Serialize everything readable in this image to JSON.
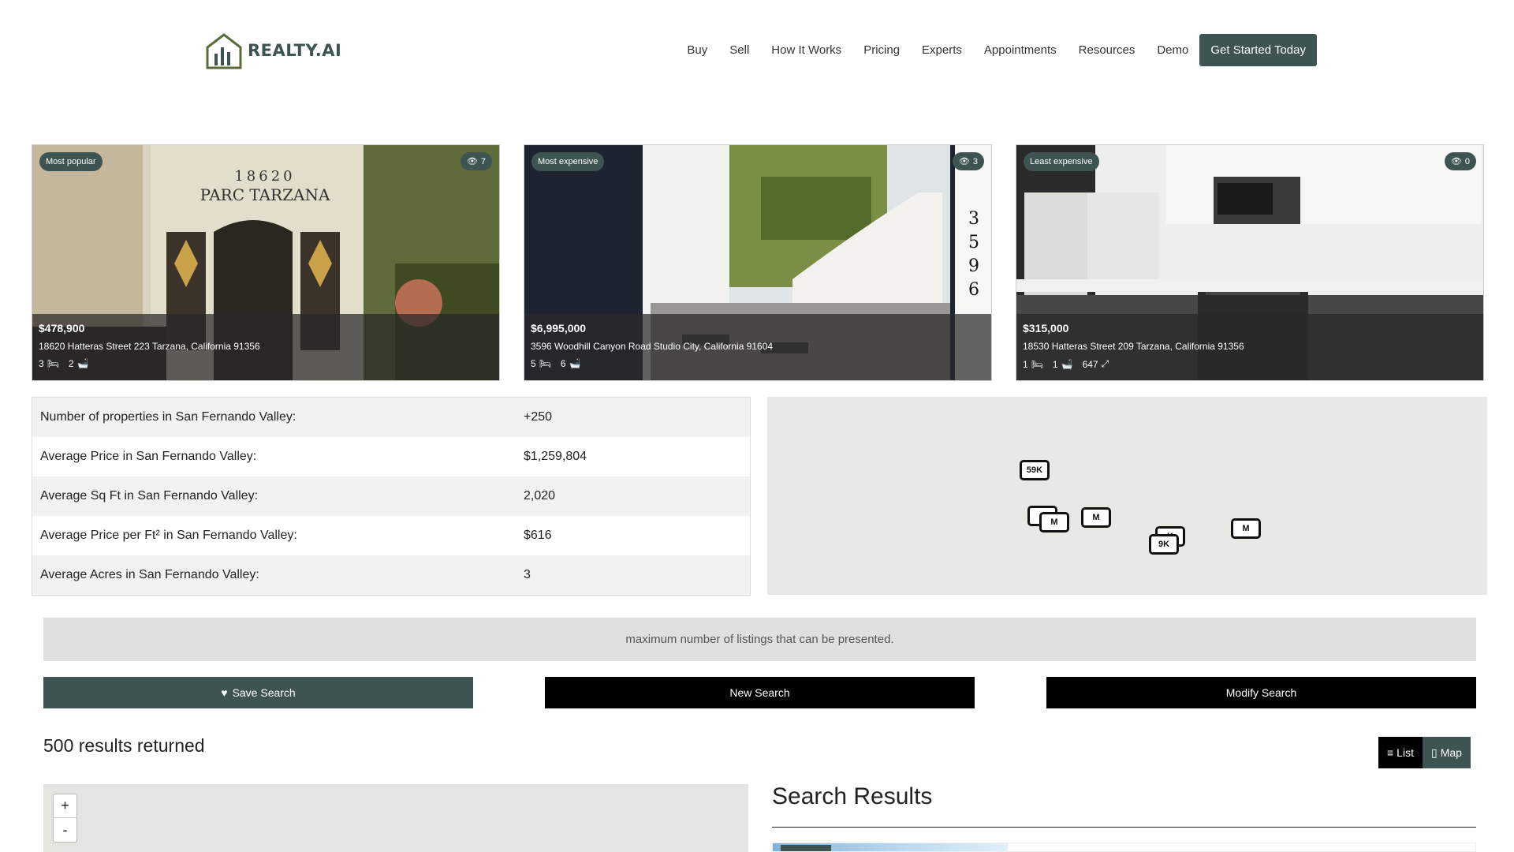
{
  "brand": {
    "name": "REALTY.AI",
    "accent": "#3e5452",
    "logo_color": "#5a6b3b"
  },
  "nav": {
    "items": [
      "Buy",
      "Sell",
      "How It Works",
      "Pricing",
      "Experts",
      "Appointments",
      "Resources",
      "Demo"
    ],
    "cta": "Get Started Today"
  },
  "featured": [
    {
      "badge": "Most popular",
      "views": "7",
      "price": "$478,900",
      "address": "18620 Hatteras Street 223 Tarzana, California 91356",
      "beds": "3",
      "baths": "2",
      "sqft": "",
      "icons": [
        "eye-icon",
        "bed-icon",
        "bath-icon"
      ]
    },
    {
      "badge": "Most expensive",
      "views": "3",
      "price": "$6,995,000",
      "address": "3596 Woodhill Canyon Road Studio City, California 91604",
      "beds": "5",
      "baths": "6",
      "sqft": "",
      "icons": [
        "eye-icon",
        "bed-icon",
        "bath-icon"
      ]
    },
    {
      "badge": "Least expensive",
      "views": "0",
      "price": "$315,000",
      "address": "18530 Hatteras Street 209 Tarzana, California 91356",
      "beds": "1",
      "baths": "1",
      "sqft": "647",
      "icons": [
        "eye-icon",
        "bed-icon",
        "bath-icon",
        "area-icon"
      ]
    }
  ],
  "stats": [
    {
      "label": "Number of properties in San Fernando Valley:",
      "value": "+250"
    },
    {
      "label": "Average Price in San Fernando Valley:",
      "value": "$1,259,804"
    },
    {
      "label": "Average Sq Ft in San Fernando Valley:",
      "value": "2,020"
    },
    {
      "label": "Average Price per Ft² in San Fernando Valley:",
      "value": "$616"
    },
    {
      "label": "Average Acres in San Fernando Valley:",
      "value": "3"
    }
  ],
  "map_markers": [
    "59K",
    "",
    "M",
    "M",
    "K",
    "9K",
    "M"
  ],
  "notice": "maximum number of listings that can be presented.",
  "actions": {
    "save": "Save Search",
    "new": "New Search",
    "modify": "Modify Search"
  },
  "results": {
    "count": "500 results returned",
    "view_list": "List",
    "view_map": "Map",
    "title": "Search Results"
  },
  "map_controls": {
    "zoom_in": "+",
    "zoom_out": "-"
  }
}
